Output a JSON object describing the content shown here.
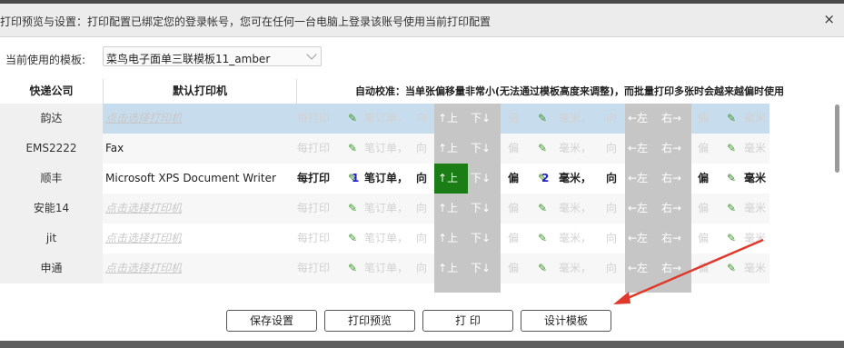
{
  "dialog": {
    "title": "打印预览与设置：打印配置已绑定您的登录帐号，您可在任何一台电脑上登录该账号使用当前打印配置",
    "close": "×"
  },
  "template": {
    "label": "当前使用的模板:",
    "value": "菜鸟电子面单三联模板11_amber"
  },
  "headers": {
    "company": "快递公司",
    "printer": "默认打印机",
    "calibration": "自动校准：当单张偏移量非常小(无法通过模板高度来调整)，而批量打印多张时会越来越偏时使用"
  },
  "labels": {
    "every_print": "每打印",
    "order_unit": "笔订单，",
    "toward": "向",
    "up": "↑上",
    "down": "下↓",
    "offset": "偏",
    "mm": "毫米，",
    "left": "←左",
    "right": "右→",
    "mm_end": "毫米",
    "pen": "✎"
  },
  "rows": [
    {
      "company": "韵达",
      "printer": "点击选择打印机",
      "n1": "",
      "n2": ""
    },
    {
      "company": "EMS2222",
      "printer": "Fax",
      "n1": "",
      "n2": ""
    },
    {
      "company": "顺丰",
      "printer": "Microsoft XPS Document Writer",
      "n1": "1",
      "n2": "2"
    },
    {
      "company": "安能14",
      "printer": "点击选择打印机",
      "n1": "",
      "n2": ""
    },
    {
      "company": "jit",
      "printer": "点击选择打印机",
      "n1": "",
      "n2": ""
    },
    {
      "company": "申通",
      "printer": "点击选择打印机",
      "n1": "",
      "n2": ""
    }
  ],
  "buttons": {
    "save": "保存设置",
    "preview": "打印预览",
    "print": "打 印",
    "design": "设计模板"
  },
  "colors": {
    "active_up": "#1b7d16",
    "selected_row": "#c7dced",
    "arrow": "#e0392b"
  }
}
